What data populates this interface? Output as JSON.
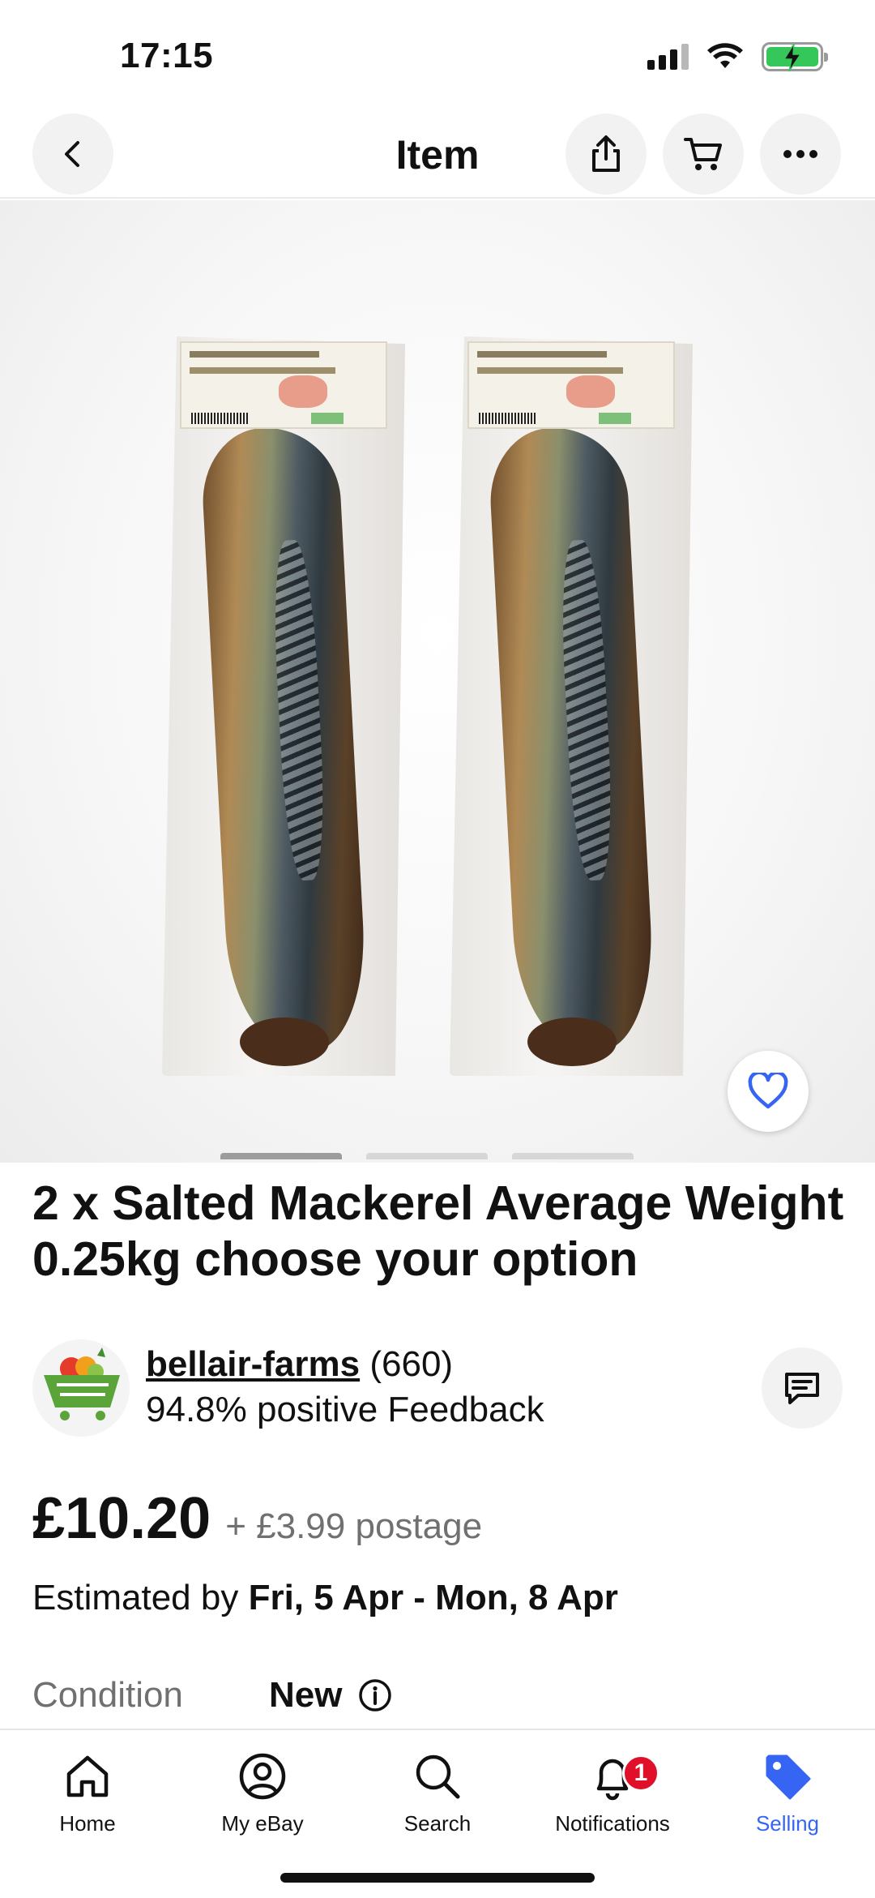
{
  "status_bar": {
    "time": "17:15"
  },
  "nav": {
    "title": "Item"
  },
  "listing": {
    "title": "2 x Salted Mackerel  Average Weight 0.25kg choose your option",
    "seller": {
      "name": "bellair-farms",
      "count": "(660)",
      "feedback": "94.8% positive Feedback"
    },
    "price": "£10.20",
    "postage": "+ £3.99 postage",
    "estimate_prefix": "Estimated by ",
    "estimate_dates": "Fri, 5 Apr - Mon, 8 Apr",
    "condition_label": "Condition",
    "condition_value": "New"
  },
  "tabs": [
    {
      "label": "Home",
      "icon": "home-icon"
    },
    {
      "label": "My eBay",
      "icon": "user-icon"
    },
    {
      "label": "Search",
      "icon": "search-icon"
    },
    {
      "label": "Notifications",
      "icon": "bell-icon",
      "badge": "1"
    },
    {
      "label": "Selling",
      "icon": "tag-icon",
      "active": true
    }
  ],
  "colors": {
    "accent": "#3665f3",
    "badge": "#e0102a",
    "battery": "#35c759"
  }
}
